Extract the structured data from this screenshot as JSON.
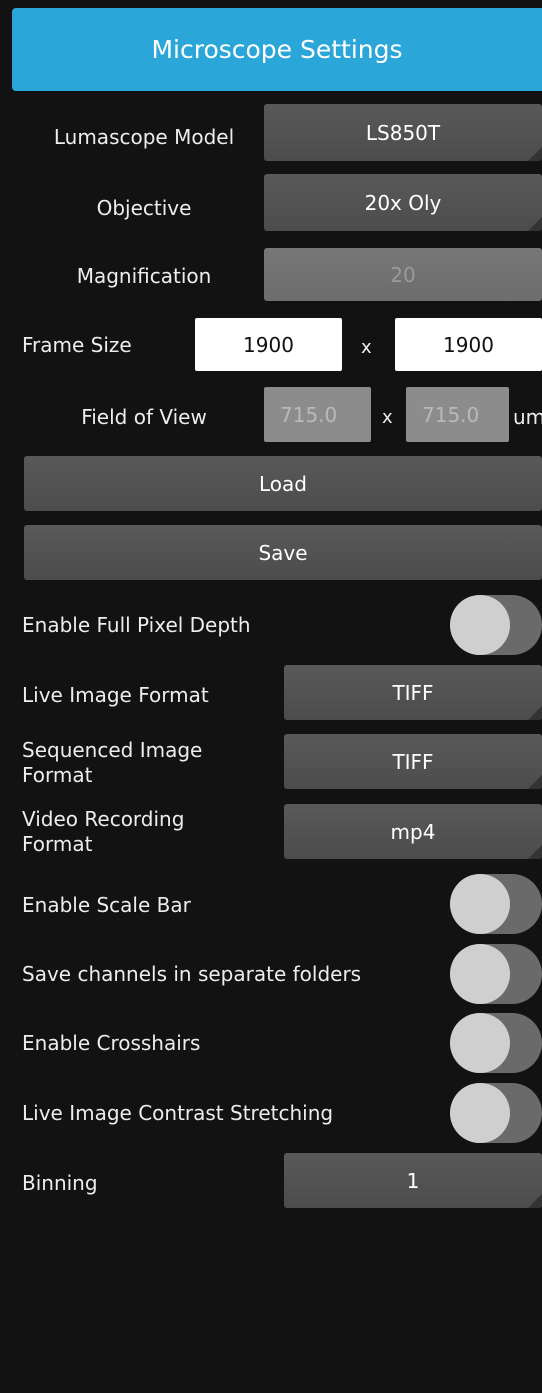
{
  "header": {
    "title": "Microscope Settings"
  },
  "model": {
    "label": "Lumascope Model",
    "value": "LS850T"
  },
  "objective": {
    "label": "Objective",
    "value": "20x Oly"
  },
  "magnification": {
    "label": "Magnification",
    "value": "20"
  },
  "frame_size": {
    "label": "Frame Size",
    "width": "1900",
    "separator": "x",
    "height": "1900"
  },
  "field_of_view": {
    "label": "Field of View",
    "width": "715.0",
    "separator": "x",
    "height": "715.0",
    "unit": "um"
  },
  "actions": {
    "load_label": "Load",
    "save_label": "Save"
  },
  "full_pixel_depth": {
    "label": "Enable Full Pixel Depth",
    "on": false
  },
  "live_image_format": {
    "label": "Live Image Format",
    "value": "TIFF"
  },
  "sequenced_image_format": {
    "label_line1": "Sequenced Image",
    "label_line2": "Format",
    "value": "TIFF"
  },
  "video_recording_format": {
    "label_line1": "Video Recording",
    "label_line2": "Format",
    "value": "mp4"
  },
  "scale_bar": {
    "label": "Enable Scale Bar",
    "on": false
  },
  "separate_folders": {
    "label": "Save channels in separate folders",
    "on": false
  },
  "crosshairs": {
    "label": "Enable Crosshairs",
    "on": false
  },
  "contrast_stretching": {
    "label": "Live Image Contrast Stretching",
    "on": false
  },
  "binning": {
    "label": "Binning",
    "value": "1"
  }
}
